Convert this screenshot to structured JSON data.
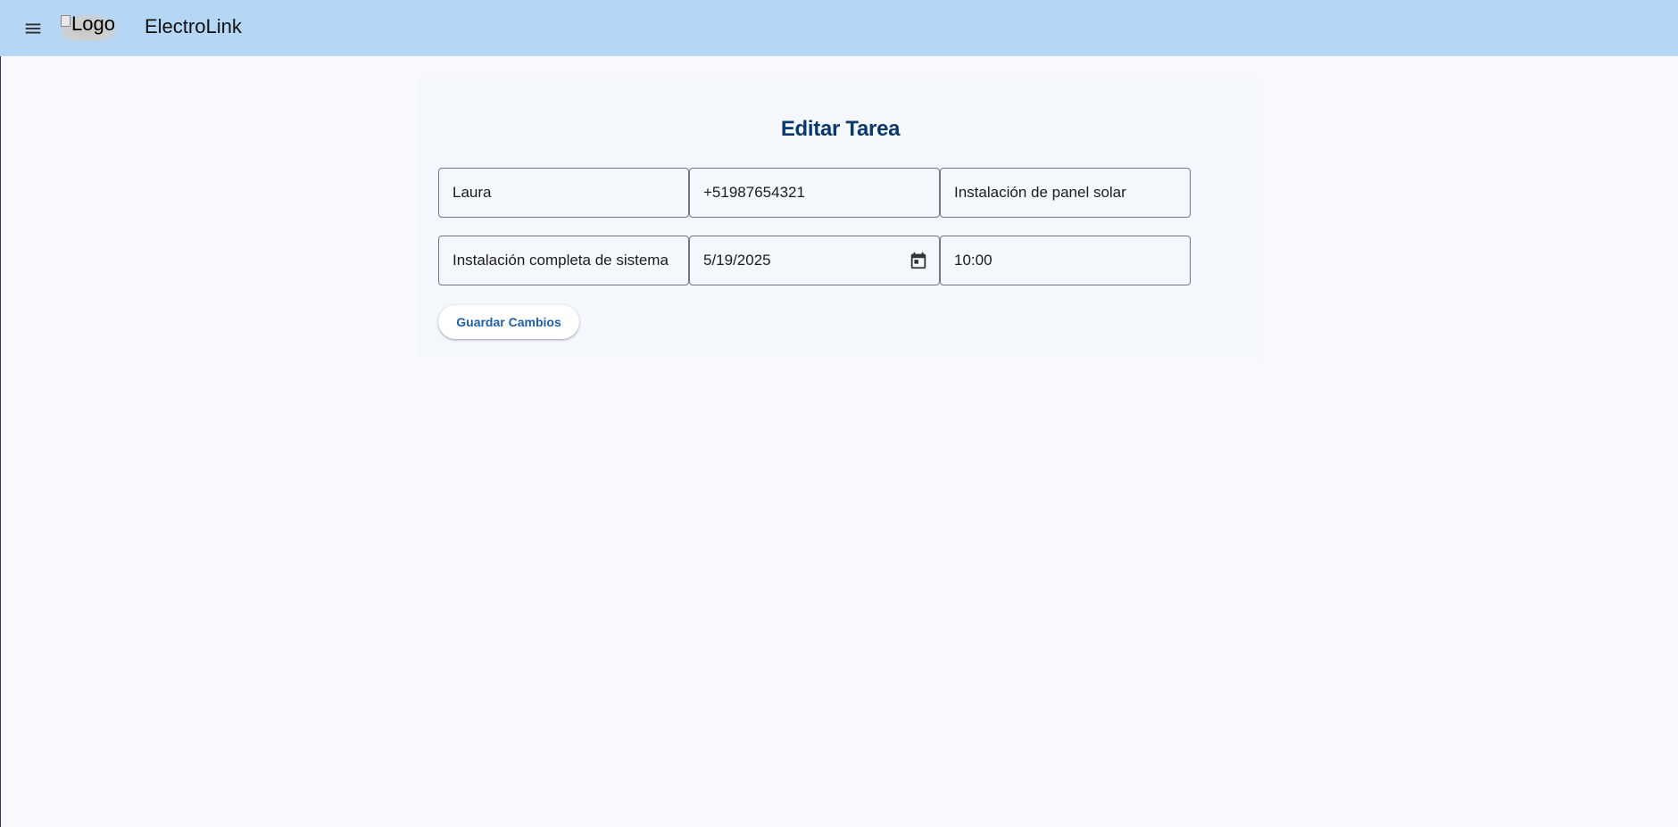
{
  "header": {
    "logo_alt": "Logo",
    "app_title": "ElectroLink",
    "menu_icon": "menu-icon"
  },
  "form": {
    "title": "Editar Tarea",
    "fields": {
      "client_name": "Laura",
      "phone": "+51987654321",
      "service": "Instalación de panel solar",
      "description": "Instalación completa de sistema",
      "date": "5/19/2025",
      "time": "10:00"
    },
    "date_icon": "calendar-icon",
    "save_label": "Guardar Cambios"
  },
  "colors": {
    "header_bg": "#b5d6f4",
    "title": "#0b3a6a",
    "button_text": "#1f5fa8",
    "page_bg": "#f9f9fd"
  }
}
